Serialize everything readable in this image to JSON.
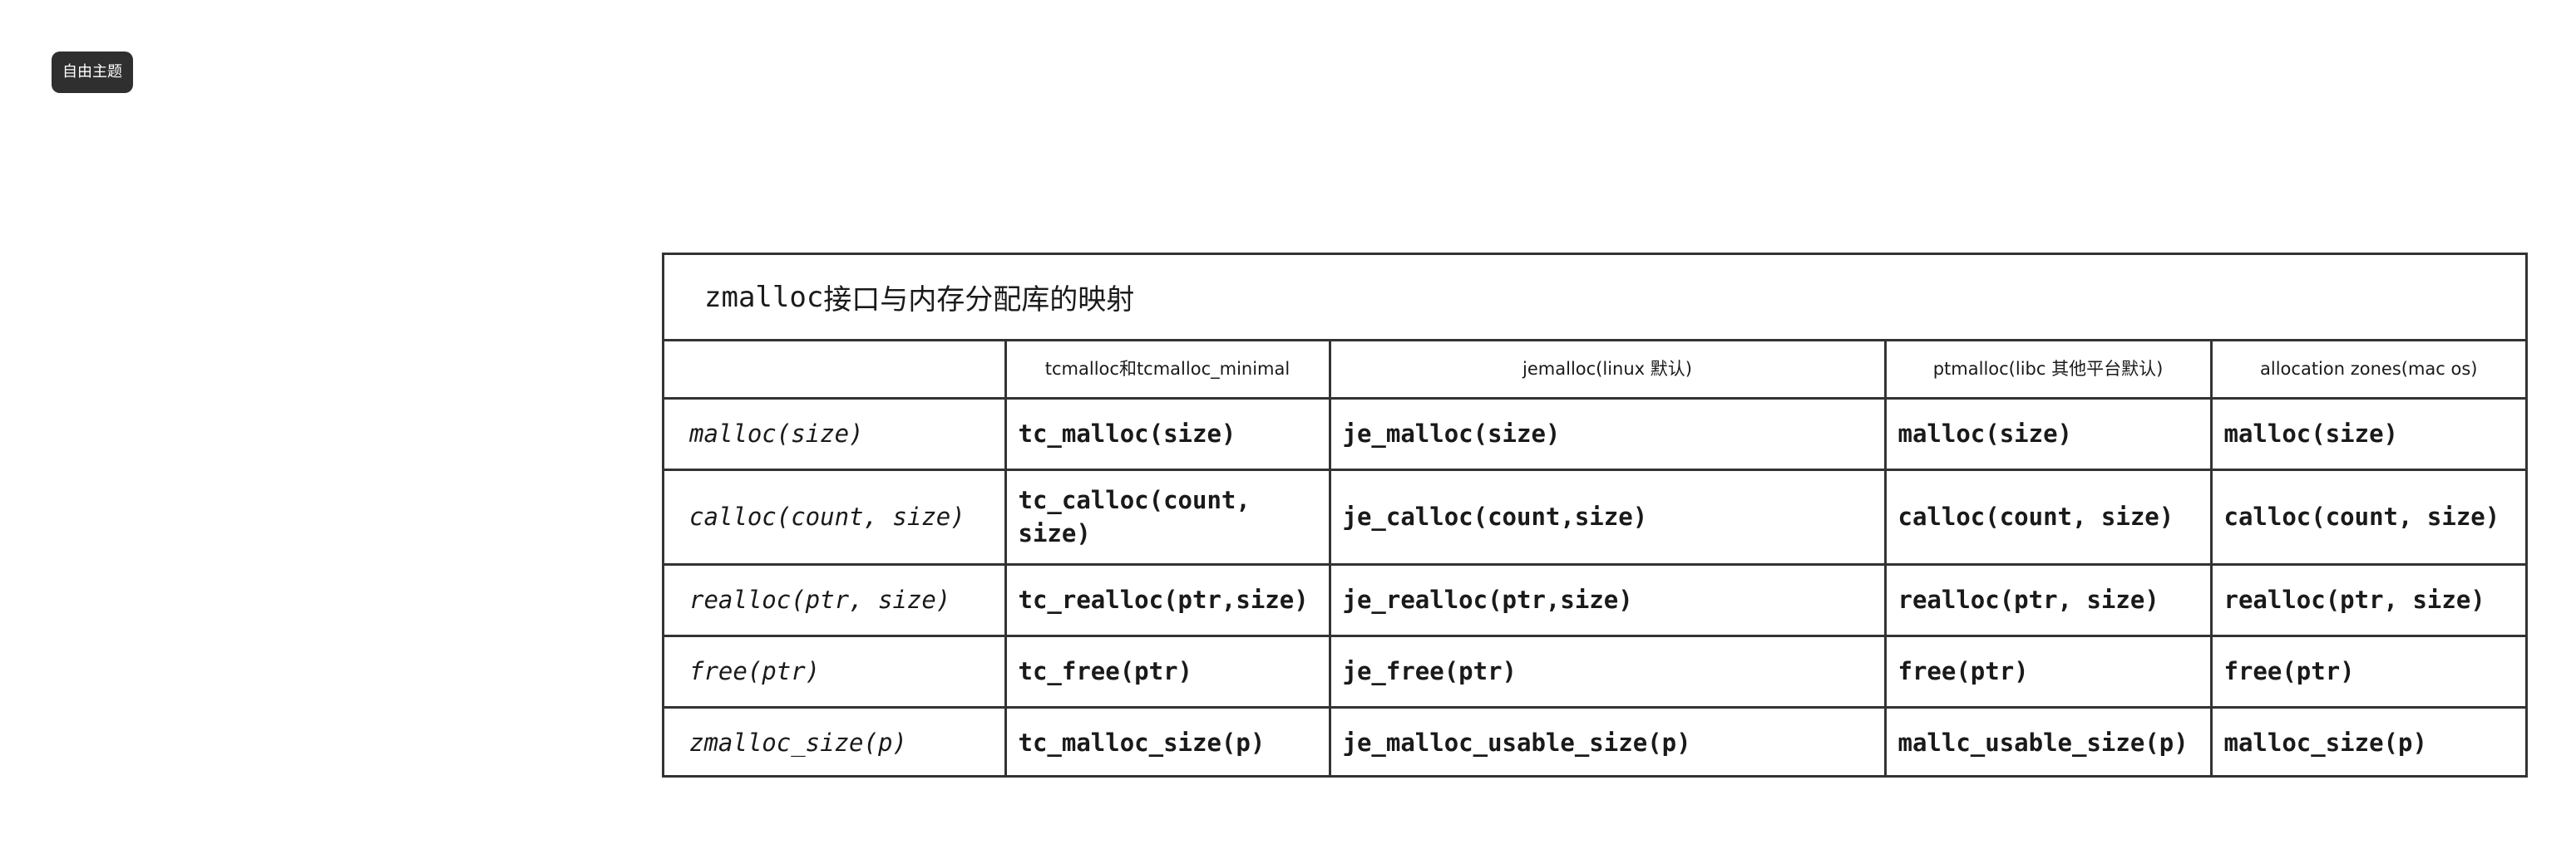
{
  "badge": {
    "label": "自由主题"
  },
  "table": {
    "title_mono": "zmalloc",
    "title_text": "接口与内存分配库的映射",
    "headers": [
      "",
      "tcmalloc和tcmalloc_minimal",
      "jemalloc(linux 默认)",
      "ptmalloc(libc 其他平台默认)",
      "allocation zones(mac os)"
    ],
    "rows": [
      {
        "fn": "malloc(size)",
        "cells": [
          "tc_malloc(size)",
          "je_malloc(size)",
          "malloc(size)",
          "malloc(size)"
        ]
      },
      {
        "fn": "calloc(count, size)",
        "cells": [
          "tc_calloc(count, size)",
          "je_calloc(count,size)",
          "calloc(count, size)",
          "calloc(count, size)"
        ]
      },
      {
        "fn": "realloc(ptr, size)",
        "cells": [
          "tc_realloc(ptr,size)",
          "je_realloc(ptr,size)",
          "realloc(ptr, size)",
          "realloc(ptr, size)"
        ]
      },
      {
        "fn": "free(ptr)",
        "cells": [
          "tc_free(ptr)",
          "je_free(ptr)",
          "free(ptr)",
          "free(ptr)"
        ]
      },
      {
        "fn": "zmalloc_size(p)",
        "cells": [
          "tc_malloc_size(p)",
          "je_malloc_usable_size(p)",
          "mallc_usable_size(p)",
          "malloc_size(p)"
        ]
      }
    ]
  }
}
